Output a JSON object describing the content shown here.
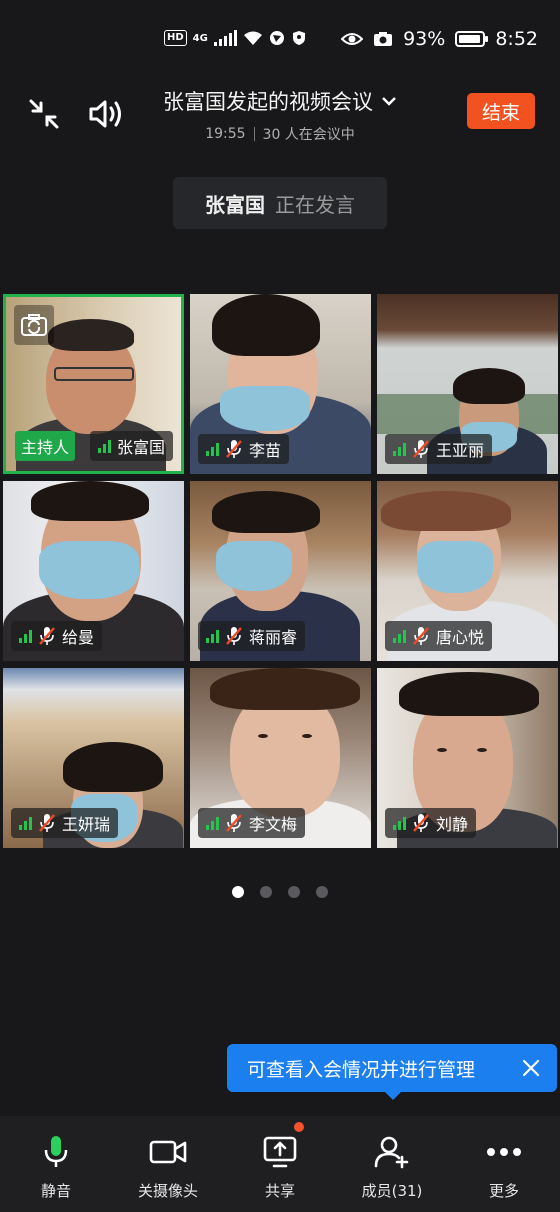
{
  "status_bar": {
    "hd_badge": "HD",
    "network": "4G",
    "battery": "93%",
    "battery_level": 0.93,
    "time": "8:52"
  },
  "header": {
    "title": "张富国发起的视频会议",
    "duration": "19:55",
    "participants_text": "30 人在会议中",
    "end_button": "结束",
    "accent_color": "#f1521f"
  },
  "speaking": {
    "name": "张富国",
    "status": "正在发言"
  },
  "participants": [
    {
      "name": "张富国",
      "host": true,
      "host_label": "主持人",
      "muted": false
    },
    {
      "name": "李苗",
      "host": false,
      "muted": true
    },
    {
      "name": "王亚丽",
      "host": false,
      "muted": true
    },
    {
      "name": "给曼",
      "host": false,
      "muted": true
    },
    {
      "name": "蒋丽睿",
      "host": false,
      "muted": true
    },
    {
      "name": "唐心悦",
      "host": false,
      "muted": true
    },
    {
      "name": "王妍瑞",
      "host": false,
      "muted": true
    },
    {
      "name": "李文梅",
      "host": false,
      "muted": true
    },
    {
      "name": "刘静",
      "host": false,
      "muted": true
    }
  ],
  "pagination": {
    "pages": 4,
    "current": 1
  },
  "toast": {
    "text": "可查看入会情况并进行管理",
    "color": "#1b7ff0"
  },
  "toolbar": {
    "items": [
      {
        "label": "静音",
        "icon": "microphone-icon"
      },
      {
        "label": "关摄像头",
        "icon": "camera-icon"
      },
      {
        "label": "共享",
        "icon": "share-screen-icon",
        "badge": true
      },
      {
        "label": "成员(31)",
        "icon": "add-member-icon"
      },
      {
        "label": "更多",
        "icon": "more-icon"
      }
    ]
  }
}
